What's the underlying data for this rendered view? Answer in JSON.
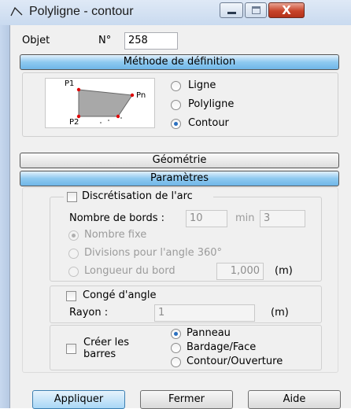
{
  "window": {
    "title": "Polyligne - contour",
    "close_glyph": "X"
  },
  "objet": {
    "label": "Objet",
    "number_label": "N°",
    "number_value": "258"
  },
  "methode": {
    "header": "Méthode de définition",
    "preview_labels": {
      "p1": "P1",
      "pn": "Pn",
      "p2": "P2"
    },
    "options": [
      {
        "label": "Ligne",
        "selected": false
      },
      {
        "label": "Polyligne",
        "selected": false
      },
      {
        "label": "Contour",
        "selected": true
      }
    ]
  },
  "sections": {
    "geometrie": "Géométrie",
    "parametres": "Paramètres"
  },
  "discretisation": {
    "checkbox_label": "Discrétisation de l'arc",
    "checked": false,
    "nombre_bords_label": "Nombre de bords :",
    "nombre_bords_value": "10",
    "min_label": "min",
    "min_value": "3",
    "options": [
      {
        "label": "Nombre fixe",
        "selected": true
      },
      {
        "label": "Divisions pour l'angle 360°",
        "selected": false
      },
      {
        "label": "Longueur du bord",
        "selected": false
      }
    ],
    "longueur_value": "1,000",
    "unit": "(m)"
  },
  "conge": {
    "checkbox_label": "Congé d'angle",
    "checked": false,
    "rayon_label": "Rayon :",
    "rayon_value": "1",
    "unit": "(m)"
  },
  "barres": {
    "checkbox_label_line1": "Créer les",
    "checkbox_label_line2": "barres",
    "checked": false,
    "options": [
      {
        "label": "Panneau",
        "selected": true
      },
      {
        "label": "Bardage/Face",
        "selected": false
      },
      {
        "label": "Contour/Ouverture",
        "selected": false
      }
    ]
  },
  "buttons": {
    "apply": "Appliquer",
    "close": "Fermer",
    "help": "Aide"
  },
  "colors": {
    "section_active": "#8ec9f0",
    "preview_shape": "#a8a8a8",
    "preview_vertex": "#e00000",
    "radio_dot": "#2a6fc0"
  }
}
